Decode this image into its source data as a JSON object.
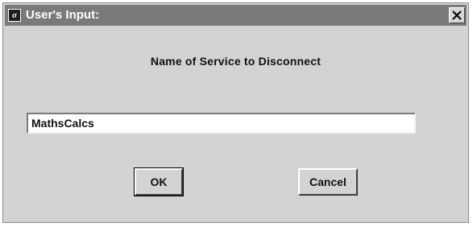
{
  "window": {
    "title": "User's Input:",
    "app_icon_glyph": "σ",
    "icons": {
      "app": "app-logo-icon",
      "close": "close-icon"
    }
  },
  "dialog": {
    "prompt": "Name of Service to Disconnect",
    "input_value": "MathsCalcs",
    "ok_label": "OK",
    "cancel_label": "Cancel"
  },
  "colors": {
    "titlebar": "#7a7a7a",
    "dialog_background": "#d3d3d3",
    "input_background": "#ffffff"
  }
}
